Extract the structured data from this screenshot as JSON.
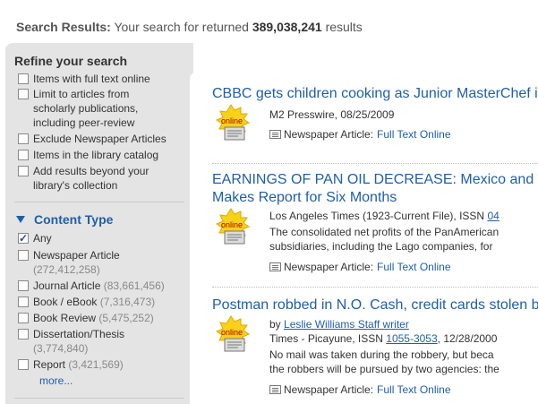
{
  "summary": {
    "label": "Search Results:",
    "text_before": " Your search for returned ",
    "count": "389,038,241",
    "text_after": " results"
  },
  "refine": {
    "title": "Refine your search",
    "options": [
      {
        "label": "Items with full text online",
        "checked": false
      },
      {
        "label": "Limit to articles from scholarly publications, including peer-review",
        "checked": false
      },
      {
        "label": "Exclude Newspaper Articles",
        "checked": false
      },
      {
        "label": "Items in the library catalog",
        "checked": false
      },
      {
        "label": "Add results beyond your library's collection",
        "checked": false
      }
    ]
  },
  "content_type": {
    "title": "Content Type",
    "items": [
      {
        "label": "Any",
        "count": "",
        "checked": true
      },
      {
        "label": "Newspaper Article",
        "count": "(272,412,258)",
        "checked": false
      },
      {
        "label": "Journal Article",
        "count": "(83,661,456)",
        "checked": false
      },
      {
        "label": "Book / eBook",
        "count": "(7,316,473)",
        "checked": false
      },
      {
        "label": "Book Review",
        "count": "(5,475,252)",
        "checked": false
      },
      {
        "label": "Dissertation/Thesis",
        "count": "(3,774,840)",
        "checked": false
      },
      {
        "label": "Report",
        "count": "(3,421,569)",
        "checked": false
      }
    ],
    "more_label": "more..."
  },
  "badge_text": "online",
  "results": [
    {
      "title": "CBBC gets children cooking as Junior MasterChef is",
      "title_line2": "",
      "source": "M2 Presswire, 08/25/2009",
      "format": "Newspaper Article:",
      "access": "Full Text Online"
    },
    {
      "title": "EARNINGS OF PAN OIL DECREASE: Mexico and V",
      "title_line2": "Makes Report for Six Months",
      "source": "Los Angeles Times (1923-Current File), ISSN ",
      "source_link": "04",
      "snippet1": "The consolidated net profits of the PanAmerican",
      "snippet2": "subsidiaries, including the Lago companies, for",
      "format": "Newspaper Article:",
      "access": "Full Text Online"
    },
    {
      "title": "Postman robbed in N.O. Cash, credit cards stolen by",
      "title_line2": "",
      "byline_prefix": "by ",
      "author": "Leslie Williams Staff writer",
      "source": "Times - Picayune, ISSN ",
      "issn": "1055-3053",
      "date": ", 12/28/2000",
      "snippet1": "No mail was taken during the robbery, but beca",
      "snippet2": "the robbers will be pursued by two agencies: the",
      "format": "Newspaper Article:",
      "access": "Full Text Online"
    }
  ]
}
